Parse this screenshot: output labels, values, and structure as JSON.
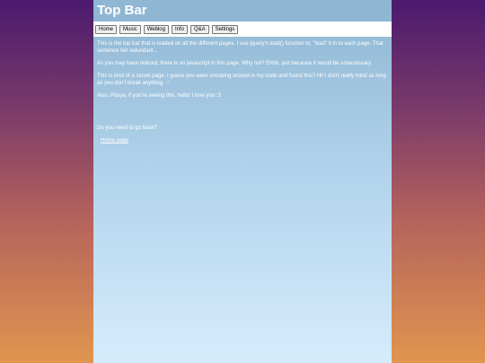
{
  "header": {
    "title": "Top Bar"
  },
  "nav": {
    "items": [
      {
        "label": "Home"
      },
      {
        "label": "Music"
      },
      {
        "label": "Weblog"
      },
      {
        "label": "Info"
      },
      {
        "label": "Q&A"
      },
      {
        "label": "Settings"
      }
    ]
  },
  "content": {
    "paragraphs": [
      "This is the top bar that is loaded on all the different pages. I use jquery's load() function to, \"load\" it in to each page. That sentence felt redundant...",
      "As you may have noticed, there is no javascript in this page. Why not? Ehhh, just because it would be unnecessary.",
      "This is kind of a secret page. I guess you were snooping around in my code and found this? Hi! I don't really mind as long as you don't break anything. ♡",
      "Also, Pitaya, if you're seeing this, hello! I love you :3"
    ],
    "back_prompt": "Do you need to go back?",
    "home_link": "Home page"
  }
}
